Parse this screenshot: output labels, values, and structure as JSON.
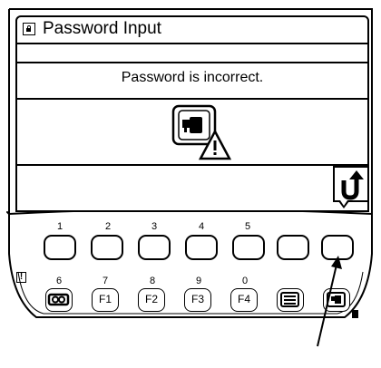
{
  "screen": {
    "title": "Password Input",
    "message": "Password is incorrect."
  },
  "keypad": {
    "top_labels": [
      "1",
      "2",
      "3",
      "4",
      "5"
    ],
    "bottom_numbers": [
      "6",
      "7",
      "8",
      "9",
      "0"
    ],
    "function_keys": [
      "F1",
      "F2",
      "F3",
      "F4"
    ],
    "warning_mark": "!"
  },
  "icons": {
    "title": "lock-icon",
    "warning": "key-warning-icon",
    "back": "return-arrow-icon",
    "seatbelt": "seatbelt-icon",
    "menu": "menu-icon",
    "machine": "machine-icon"
  }
}
